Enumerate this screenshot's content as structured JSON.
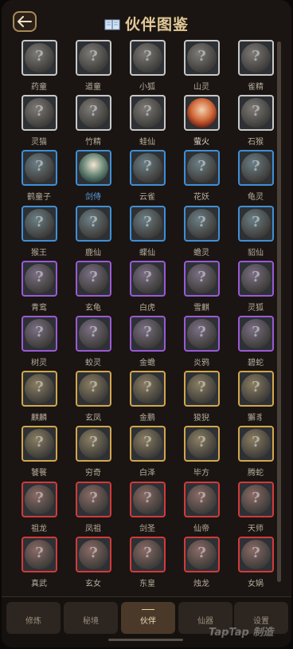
{
  "header": {
    "title": "伙伴图鉴"
  },
  "rarity_colors": {
    "white": "#c8c8c8",
    "blue": "#3f8fd6",
    "purple": "#9a5ad6",
    "gold": "#d2a64a",
    "red": "#d23a3a"
  },
  "companions": [
    {
      "name": "药童",
      "rarity": "white",
      "unlocked": false
    },
    {
      "name": "道童",
      "rarity": "white",
      "unlocked": false
    },
    {
      "name": "小狐",
      "rarity": "white",
      "unlocked": false
    },
    {
      "name": "山灵",
      "rarity": "white",
      "unlocked": false
    },
    {
      "name": "雀精",
      "rarity": "white",
      "unlocked": false
    },
    {
      "name": "灵猫",
      "rarity": "white",
      "unlocked": false
    },
    {
      "name": "竹精",
      "rarity": "white",
      "unlocked": false
    },
    {
      "name": "蛙仙",
      "rarity": "white",
      "unlocked": false
    },
    {
      "name": "萤火",
      "rarity": "white",
      "unlocked": true
    },
    {
      "name": "石猴",
      "rarity": "white",
      "unlocked": false
    },
    {
      "name": "鹤童子",
      "rarity": "blue",
      "unlocked": false
    },
    {
      "name": "剑侍",
      "rarity": "blue",
      "unlocked": true
    },
    {
      "name": "云雀",
      "rarity": "blue",
      "unlocked": false
    },
    {
      "name": "花妖",
      "rarity": "blue",
      "unlocked": false
    },
    {
      "name": "龟灵",
      "rarity": "blue",
      "unlocked": false
    },
    {
      "name": "猴王",
      "rarity": "blue",
      "unlocked": false
    },
    {
      "name": "鹿仙",
      "rarity": "blue",
      "unlocked": false
    },
    {
      "name": "蝶仙",
      "rarity": "blue",
      "unlocked": false
    },
    {
      "name": "蟾灵",
      "rarity": "blue",
      "unlocked": false
    },
    {
      "name": "貂仙",
      "rarity": "blue",
      "unlocked": false
    },
    {
      "name": "青鸾",
      "rarity": "purple",
      "unlocked": false
    },
    {
      "name": "玄龟",
      "rarity": "purple",
      "unlocked": false
    },
    {
      "name": "白虎",
      "rarity": "purple",
      "unlocked": false
    },
    {
      "name": "雪麒",
      "rarity": "purple",
      "unlocked": false
    },
    {
      "name": "灵狐",
      "rarity": "purple",
      "unlocked": false
    },
    {
      "name": "树灵",
      "rarity": "purple",
      "unlocked": false
    },
    {
      "name": "蛟灵",
      "rarity": "purple",
      "unlocked": false
    },
    {
      "name": "金蟾",
      "rarity": "purple",
      "unlocked": false
    },
    {
      "name": "炎鸦",
      "rarity": "purple",
      "unlocked": false
    },
    {
      "name": "碧蛇",
      "rarity": "purple",
      "unlocked": false
    },
    {
      "name": "麒麟",
      "rarity": "gold",
      "unlocked": false
    },
    {
      "name": "玄凤",
      "rarity": "gold",
      "unlocked": false
    },
    {
      "name": "金鹏",
      "rarity": "gold",
      "unlocked": false
    },
    {
      "name": "狻猊",
      "rarity": "gold",
      "unlocked": false
    },
    {
      "name": "獬豸",
      "rarity": "gold",
      "unlocked": false
    },
    {
      "name": "饕餮",
      "rarity": "gold",
      "unlocked": false
    },
    {
      "name": "穷奇",
      "rarity": "gold",
      "unlocked": false
    },
    {
      "name": "白泽",
      "rarity": "gold",
      "unlocked": false
    },
    {
      "name": "毕方",
      "rarity": "gold",
      "unlocked": false
    },
    {
      "name": "腾蛇",
      "rarity": "gold",
      "unlocked": false
    },
    {
      "name": "祖龙",
      "rarity": "red",
      "unlocked": false
    },
    {
      "name": "凤祖",
      "rarity": "red",
      "unlocked": false
    },
    {
      "name": "剑圣",
      "rarity": "red",
      "unlocked": false
    },
    {
      "name": "仙帝",
      "rarity": "red",
      "unlocked": false
    },
    {
      "name": "天师",
      "rarity": "red",
      "unlocked": false
    },
    {
      "name": "真武",
      "rarity": "red",
      "unlocked": false
    },
    {
      "name": "玄女",
      "rarity": "red",
      "unlocked": false
    },
    {
      "name": "东皇",
      "rarity": "red",
      "unlocked": false
    },
    {
      "name": "烛龙",
      "rarity": "red",
      "unlocked": false
    },
    {
      "name": "女娲",
      "rarity": "red",
      "unlocked": false
    }
  ],
  "tabs": [
    {
      "label": "修炼",
      "active": false
    },
    {
      "label": "秘境",
      "active": false
    },
    {
      "label": "伙伴",
      "active": true
    },
    {
      "label": "仙器",
      "active": false
    },
    {
      "label": "设置",
      "active": false
    }
  ],
  "watermark": "TapTap 制造"
}
